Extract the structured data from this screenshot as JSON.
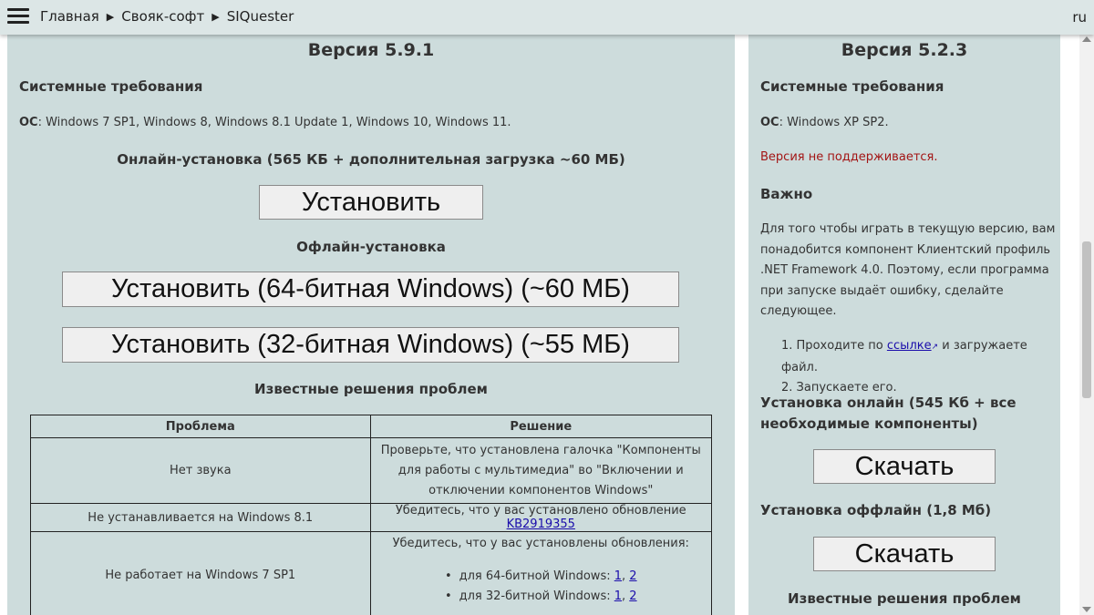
{
  "topbar": {
    "breadcrumbs": [
      "Главная",
      "Свояк-софт",
      "SIQuester"
    ],
    "separator": "▶",
    "language": "ru"
  },
  "left": {
    "version_title": "Версия 5.9.1",
    "sysreq_heading": "Системные требования",
    "os_label": "ОС",
    "os_value": ": Windows 7 SP1, Windows 8, Windows 8.1 Update 1, Windows 10, Windows 11.",
    "online_heading": "Онлайн-установка (565 КБ + дополнительная загрузка ~60 МБ)",
    "install_button": "Установить",
    "offline_heading": "Офлайн-установка",
    "install_64_button": "Установить (64-битная Windows) (~60 МБ)",
    "install_32_button": "Установить (32-битная Windows) (~55 МБ)",
    "known_issues_heading": "Известные решения проблем",
    "table": {
      "headers": [
        "Проблема",
        "Решение"
      ],
      "rows": [
        {
          "problem": "Нет звука",
          "solution": "Проверьте, что установлена галочка \"Компоненты для работы с мультимедиа\" во \"Включении и отключении компонентов Windows\""
        },
        {
          "problem": "Не устанавливается на Windows 8.1",
          "solution": "Убедитесь, что у вас установлено обновление ",
          "link": "KB2919355"
        },
        {
          "problem": "Не работает на Windows 7 SP1",
          "solution": "Убедитесь, что у вас установлены обновления:",
          "items": [
            {
              "text": "для 64-битной Windows: ",
              "links": [
                "1",
                "2"
              ]
            },
            {
              "text": "для 32-битной Windows: ",
              "links": [
                "1",
                "2"
              ]
            }
          ]
        }
      ]
    }
  },
  "right": {
    "version_title": "Версия 5.2.3",
    "sysreq_heading": "Системные требования",
    "os_label": "ОС",
    "os_value": ": Windows XP SP2.",
    "unsupported": "Версия не поддерживается.",
    "important_heading": "Важно",
    "important_lines": [
      "Для того чтобы играть в текущую версию, вам",
      "понадобится компонент Клиентский профиль",
      ".NET Framework 4.0. Поэтому, если программа",
      "при запуске выдаёт ошибку, сделайте",
      "следующее."
    ],
    "step1_prefix": "1. Проходите по ",
    "step1_link": "ссылке",
    "step1_suffix": " и загружаете файл.",
    "step2": "2. Запускаете его.",
    "online_heading_line1": "Установка онлайн (545 Кб + все",
    "online_heading_line2": "необходимые компоненты)",
    "download_online_button": "Скачать",
    "offline_heading": "Установка оффлайн (1,8 Мб)",
    "download_offline_button": "Скачать",
    "known_issues_heading": "Известные решения проблем"
  },
  "colors": {
    "panel": "#cddcdc",
    "topbar": "#dce6e6",
    "link": "#1a0dab",
    "warning": "#a31515"
  }
}
